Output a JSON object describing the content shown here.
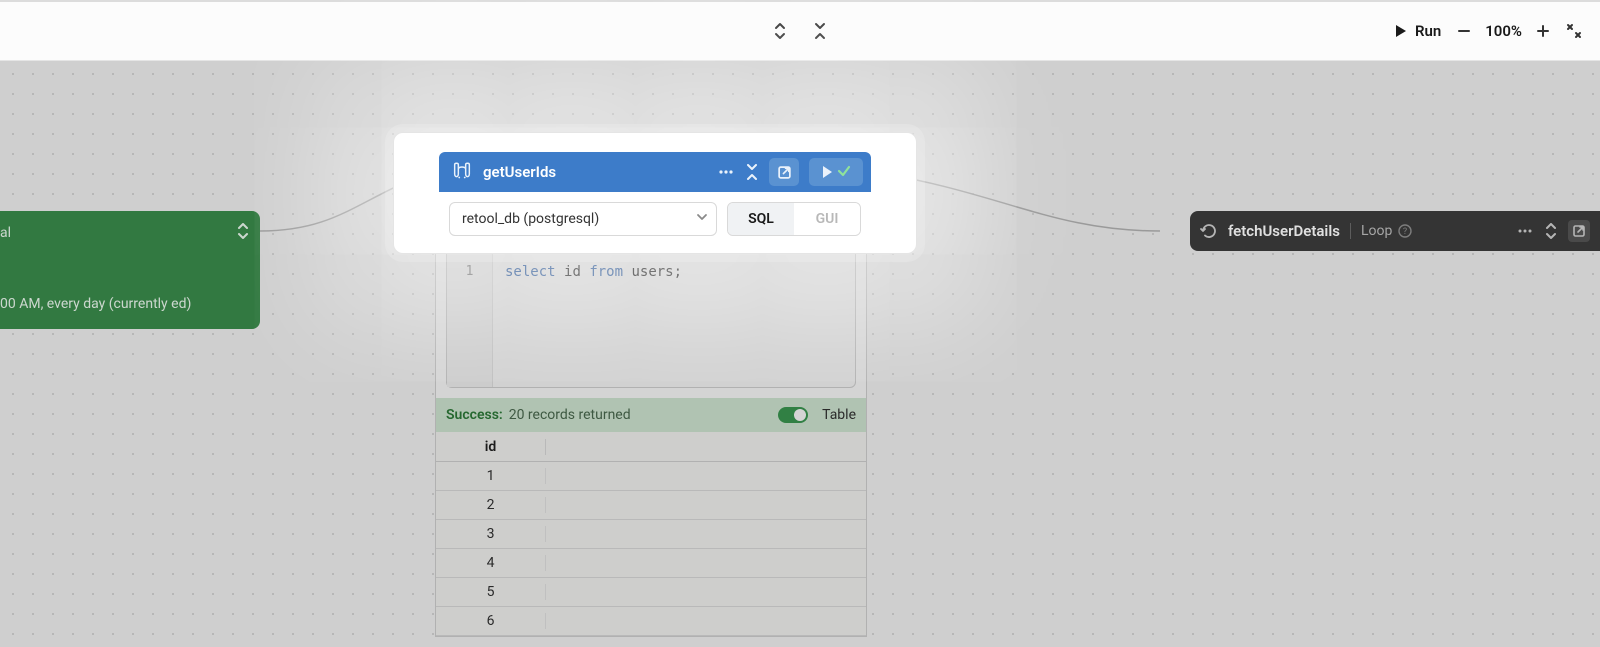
{
  "topbar": {
    "run_label": "Run",
    "zoom_label": "100%"
  },
  "trigger": {
    "line1_suffix": "al",
    "line2": "00 AM, every day (currently ed)"
  },
  "fetch_node": {
    "title": "fetchUserDetails",
    "subtitle": "Loop"
  },
  "query_node": {
    "name": "getUserIds",
    "resource_label": "retool_db (postgresql)",
    "mode_sql": "SQL",
    "mode_gui": "GUI",
    "code": {
      "line_number": "1",
      "kw1": "select",
      "kw2": "from",
      "ident": "id",
      "rest": " users;"
    },
    "status": {
      "label": "Success:",
      "message": "20 records returned",
      "view_label": "Table"
    },
    "table": {
      "header": "id",
      "rows": [
        "1",
        "2",
        "3",
        "4",
        "5",
        "6"
      ]
    }
  }
}
